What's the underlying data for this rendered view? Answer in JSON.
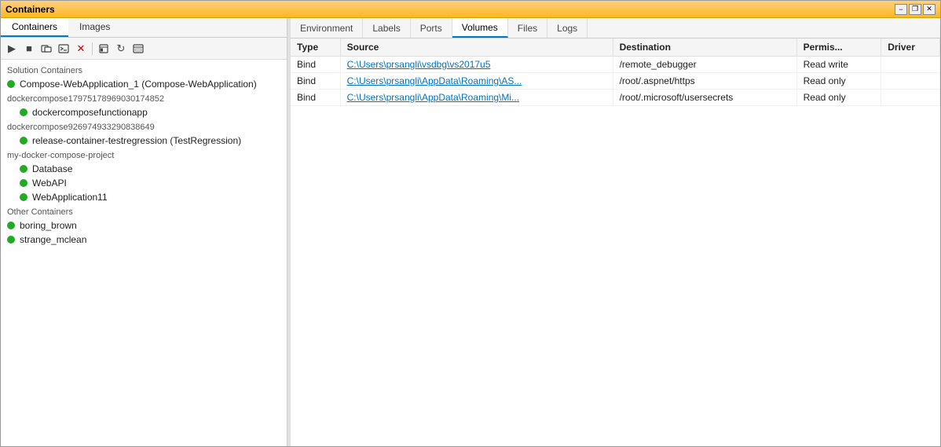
{
  "window": {
    "title": "Containers"
  },
  "title_bar_controls": {
    "minimize": "−",
    "restore": "❐",
    "close": "✕"
  },
  "sidebar_tabs": [
    {
      "label": "Containers",
      "active": true
    },
    {
      "label": "Images",
      "active": false
    }
  ],
  "toolbar_buttons": [
    {
      "name": "play",
      "icon": "▶"
    },
    {
      "name": "stop",
      "icon": "■"
    },
    {
      "name": "attach",
      "icon": "⊡"
    },
    {
      "name": "shell",
      "icon": "▣"
    },
    {
      "name": "delete",
      "icon": "✕"
    },
    {
      "name": "build",
      "icon": "⬛"
    },
    {
      "name": "refresh",
      "icon": "↻"
    },
    {
      "name": "more",
      "icon": "⊞"
    }
  ],
  "groups": [
    {
      "name": "Solution Containers",
      "items": [
        {
          "label": "Compose-WebApplication_1 (Compose-WebApplication)",
          "has_dot": true,
          "indent": 0
        }
      ]
    },
    {
      "name": "dockercompose17975178969030174852",
      "items": [
        {
          "label": "dockercomposefunctionapp",
          "has_dot": true,
          "indent": 1
        }
      ]
    },
    {
      "name": "dockercompose926974933290838649",
      "items": [
        {
          "label": "release-container-testregression (TestRegression)",
          "has_dot": true,
          "indent": 1
        }
      ]
    },
    {
      "name": "my-docker-compose-project",
      "items": [
        {
          "label": "Database",
          "has_dot": true,
          "indent": 1
        },
        {
          "label": "WebAPI",
          "has_dot": true,
          "indent": 1
        },
        {
          "label": "WebApplication11",
          "has_dot": true,
          "indent": 1
        }
      ]
    },
    {
      "name": "Other Containers",
      "items": [
        {
          "label": "boring_brown",
          "has_dot": true,
          "indent": 0
        },
        {
          "label": "strange_mclean",
          "has_dot": true,
          "indent": 0
        }
      ]
    }
  ],
  "detail_tabs": [
    {
      "label": "Environment",
      "active": false
    },
    {
      "label": "Labels",
      "active": false
    },
    {
      "label": "Ports",
      "active": false
    },
    {
      "label": "Volumes",
      "active": true
    },
    {
      "label": "Files",
      "active": false
    },
    {
      "label": "Logs",
      "active": false
    }
  ],
  "table": {
    "columns": [
      "Type",
      "Source",
      "Destination",
      "Permis...",
      "Driver"
    ],
    "rows": [
      {
        "type": "Bind",
        "source": "C:\\Users\\prsangli\\vsdbg\\vs2017u5",
        "destination": "/remote_debugger",
        "permissions": "Read write",
        "driver": ""
      },
      {
        "type": "Bind",
        "source": "C:\\Users\\prsangli\\AppData\\Roaming\\AS...",
        "destination": "/root/.aspnet/https",
        "permissions": "Read only",
        "driver": ""
      },
      {
        "type": "Bind",
        "source": "C:\\Users\\prsangli\\AppData\\Roaming\\Mi...",
        "destination": "/root/.microsoft/usersecrets",
        "permissions": "Read only",
        "driver": ""
      }
    ]
  }
}
